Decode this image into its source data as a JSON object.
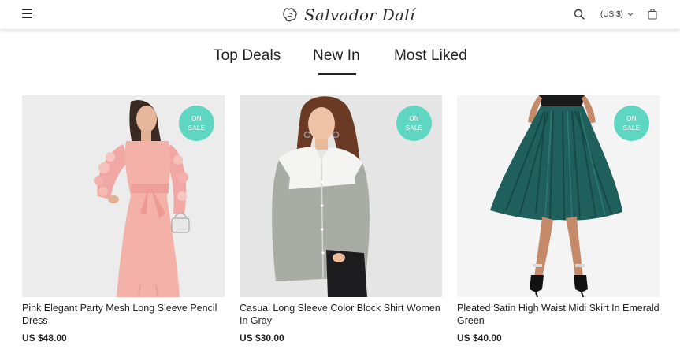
{
  "header": {
    "menu_icon": "hamburger-icon",
    "logo_text": "Salvador Dalí",
    "logo_icon": "logo-mark-icon",
    "search_icon": "search-icon",
    "currency_label": "(US $)",
    "currency_chevron": "chevron-down-icon",
    "bag_icon": "shopping-bag-icon"
  },
  "tabs": [
    {
      "label": "Top Deals",
      "active": false
    },
    {
      "label": "New In",
      "active": true
    },
    {
      "label": "Most Liked",
      "active": false
    }
  ],
  "products": [
    {
      "badge_line1": "ON",
      "badge_line2": "SALE",
      "title": "Pink Elegant Party Mesh Long Sleeve Pencil Dress",
      "price": "US $48.00"
    },
    {
      "badge_line1": "ON",
      "badge_line2": "SALE",
      "title": "Casual Long Sleeve Color Block Shirt Women In Gray",
      "price": "US $30.00"
    },
    {
      "badge_line1": "ON",
      "badge_line2": "SALE",
      "title": "Pleated Satin High Waist Midi Skirt In Emerald Green",
      "price": "US $40.00"
    }
  ],
  "colors": {
    "badge": "#5fd6c1",
    "text": "#222222",
    "dress": "#f4b1a8",
    "skirt": "#1f5f5c"
  }
}
